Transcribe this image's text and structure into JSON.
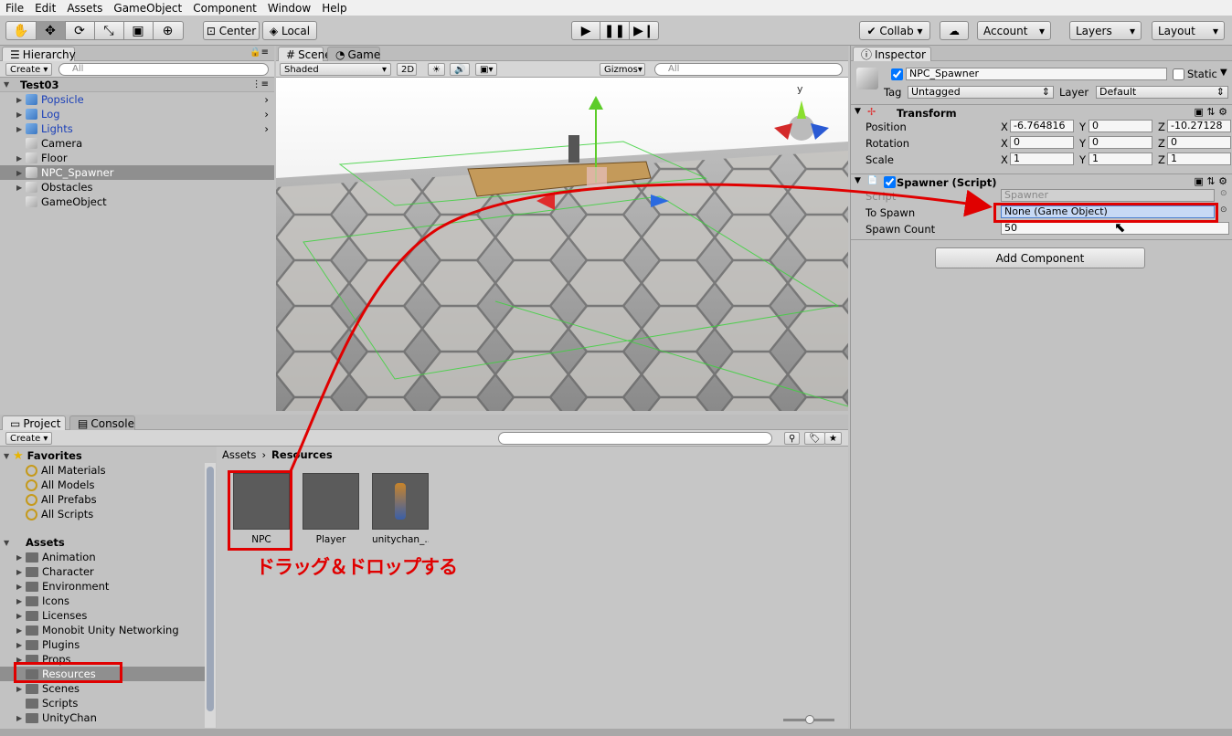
{
  "menu": [
    "File",
    "Edit",
    "Assets",
    "GameObject",
    "Component",
    "Window",
    "Help"
  ],
  "toolbar": {
    "center_label": "Center",
    "local_label": "Local",
    "collab_label": "Collab",
    "account_label": "Account",
    "layers_label": "Layers",
    "layout_label": "Layout"
  },
  "hierarchy": {
    "tab": "Hierarchy",
    "create_label": "Create",
    "search_placeholder": "All",
    "scene_name": "Test03",
    "items": [
      {
        "label": "Popsicle",
        "prefab": true,
        "expand": true,
        "arrow": true
      },
      {
        "label": "Log",
        "prefab": true,
        "expand": true,
        "arrow": true
      },
      {
        "label": "Lights",
        "prefab": true,
        "expand": true,
        "arrow": true
      },
      {
        "label": "Camera",
        "prefab": false,
        "expand": false,
        "arrow": false
      },
      {
        "label": "Floor",
        "prefab": false,
        "expand": true,
        "arrow": false
      },
      {
        "label": "NPC_Spawner",
        "prefab": false,
        "expand": true,
        "arrow": false,
        "selected": true
      },
      {
        "label": "Obstacles",
        "prefab": false,
        "expand": true,
        "arrow": false
      },
      {
        "label": "GameObject",
        "prefab": false,
        "expand": false,
        "arrow": false
      }
    ]
  },
  "scene": {
    "tab_scene": "Scene",
    "tab_game": "Game",
    "shading_label": "Shaded",
    "mode_label": "2D",
    "gizmos_label": "Gizmos",
    "search_placeholder": "All",
    "gizmo_axis": "y"
  },
  "project": {
    "tab_project": "Project",
    "tab_console": "Console",
    "create_label": "Create",
    "favorites_label": "Favorites",
    "favorites": [
      "All Materials",
      "All Models",
      "All Prefabs",
      "All Scripts"
    ],
    "assets_label": "Assets",
    "folders": [
      "Animation",
      "Character",
      "Environment",
      "Icons",
      "Licenses",
      "Monobit Unity Networking",
      "Plugins",
      "Props",
      "Resources",
      "Scenes",
      "Scripts",
      "UnityChan"
    ],
    "breadcrumb": [
      "Assets",
      "Resources"
    ],
    "assets": [
      "NPC",
      "Player",
      "unitychan_..."
    ]
  },
  "annotation": "ドラッグ＆ドロップする",
  "inspector": {
    "tab": "Inspector",
    "object_name": "NPC_Spawner",
    "static_label": "Static",
    "tag_label": "Tag",
    "tag_value": "Untagged",
    "layer_label": "Layer",
    "layer_value": "Default",
    "transform": {
      "title": "Transform",
      "rows": [
        {
          "label": "Position",
          "x": "-6.764816",
          "y": "0",
          "z": "-10.27128"
        },
        {
          "label": "Rotation",
          "x": "0",
          "y": "0",
          "z": "0"
        },
        {
          "label": "Scale",
          "x": "1",
          "y": "1",
          "z": "1"
        }
      ]
    },
    "spawner": {
      "title": "Spawner (Script)",
      "script_label": "Script",
      "script_value": "Spawner",
      "to_spawn_label": "To Spawn",
      "to_spawn_value": "None (Game Object)",
      "count_label": "Spawn Count",
      "count_value": "50"
    },
    "add_component_label": "Add Component"
  },
  "colors": {
    "highlight_red": "#e00000",
    "prefab_blue": "#1a3fb8",
    "selection": "#8f8f8f",
    "field_active": "#c7d9f5"
  }
}
